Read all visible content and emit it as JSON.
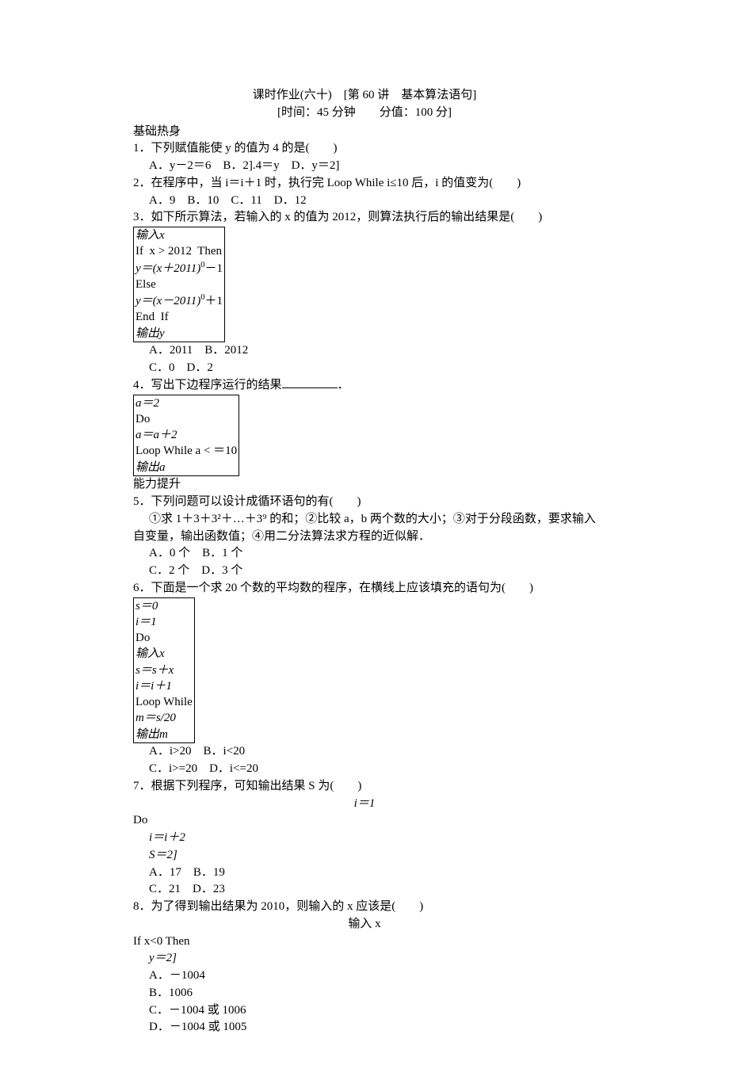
{
  "title": "课时作业(六十)　[第 60 讲　基本算法语句]",
  "subtitle": "[时间：45 分钟　　分值：100 分]",
  "sections": {
    "s1": "基础热身",
    "s2": "能力提升"
  },
  "q1": {
    "stem": "1．下列赋值能使 y 的值为 4 的是(　　)",
    "opts": "A．y－2＝6　B．2].4＝y　D．y＝2]"
  },
  "q2": {
    "stem": "2．在程序中，当 i＝i＋1 时，执行完 Loop While i≤10 后，i 的值变为(　　)",
    "opts": "A．9　B．10　C．11　D．12"
  },
  "q3": {
    "stem": "3．如下所示算法，若输入的 x 的值为 2012，则算法执行后的输出结果是(　　)",
    "code1": "输入x",
    "code2": "If  x > 2012  Then",
    "code3": "y＝(x＋2011)",
    "code3sup": "0",
    "code3tail": "－1",
    "code4": "Else",
    "code5": "y＝(x－2011)",
    "code5sup": "0",
    "code5tail": "＋1",
    "code6": "End  If",
    "code7": "输出y",
    "opts1": "A．2011　B．2012",
    "opts2": "C．0　D．2"
  },
  "q4": {
    "stem": "4．写出下边程序运行的结果",
    "tail": "．",
    "code1": "a＝2",
    "code2": "Do",
    "code3": "a＝a＋2",
    "code4": "Loop While a < ＝10",
    "code5": "输出a"
  },
  "q5": {
    "stem": "5．下列问题可以设计成循环语句的有(　　)",
    "body": "①求 1＋3＋3²＋…＋3⁹ 的和；②比较 a，b 两个数的大小；③对于分段函数，要求输入自变量，输出函数值；④用二分法算法求方程的近似解．",
    "opts1": "A．0 个　B．1 个",
    "opts2": "C．2 个　D．3 个"
  },
  "q6": {
    "stem": "6．下面是一个求 20 个数的平均数的程序，在横线上应该填充的语句为(　　)",
    "code1": "s＝0",
    "code2": "i＝1",
    "code3": "Do",
    "code4": "输入x",
    "code5": "s＝s＋x",
    "code6": "i＝i＋1",
    "code7": "Loop While",
    "code8": "m＝s/20",
    "code9": "输出m",
    "opts1": "A．i>20　B．i<20",
    "opts2": "C．i>=20　D．i<=20"
  },
  "q7": {
    "stem": "7．根据下列程序，可知输出结果 S 为(　　)",
    "code1": "i＝1",
    "code2": "Do",
    "code3": "  i＝i＋2",
    "code4": "  S＝2]",
    "opts1": "A．17　B．19",
    "opts2": "C．21　D．23"
  },
  "q8": {
    "stem": "8．为了得到输出结果为 2010，则输入的 x 应该是(　　)",
    "code1": "输入 x",
    "code2": "If x<0 Then",
    "code3": "  y＝2]",
    "opts1": "A．－1004",
    "opts2": "B．1006",
    "opts3": "C．－1004 或 1006",
    "opts4": "D．－1004 或 1005"
  }
}
